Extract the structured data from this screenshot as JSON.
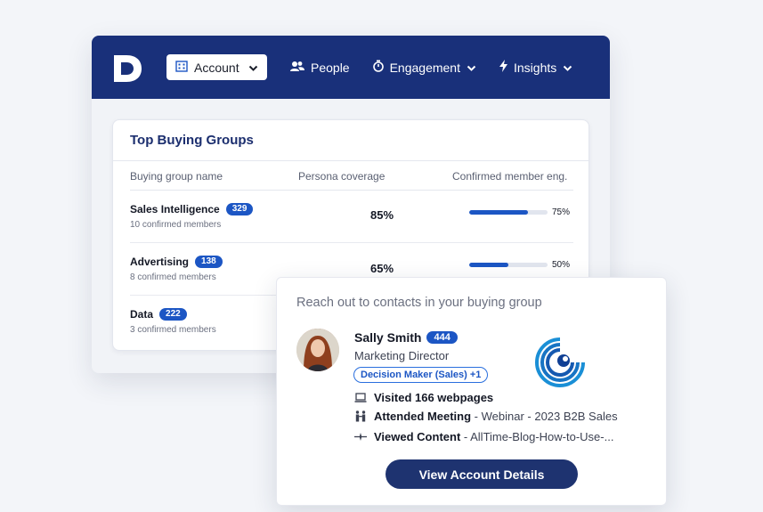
{
  "nav": {
    "account_label": "Account",
    "people_label": "People",
    "engagement_label": "Engagement",
    "insights_label": "Insights"
  },
  "card": {
    "title": "Top Buying Groups",
    "columns": [
      "Buying group name",
      "Persona coverage",
      "Confirmed member eng."
    ],
    "rows": [
      {
        "name": "Sales Intelligence",
        "count": "329",
        "sub": "10 confirmed members",
        "coverage": "85%",
        "engagement": 0.75,
        "engagement_label": "75%"
      },
      {
        "name": "Advertising",
        "count": "138",
        "sub": "8 confirmed members",
        "coverage": "65%",
        "engagement": 0.5,
        "engagement_label": "50%"
      },
      {
        "name": "Data",
        "count": "222",
        "sub": "3 confirmed members",
        "coverage": "",
        "engagement": null,
        "engagement_label": ""
      }
    ]
  },
  "popup": {
    "title": "Reach out to contacts in your buying group",
    "contact_name": "Sally Smith",
    "contact_count": "444",
    "contact_title": "Marketing Director",
    "tag": "Decision Maker (Sales) +1",
    "activities": [
      {
        "icon": "laptop-icon",
        "bold": "Visited 166 webpages",
        "rest": ""
      },
      {
        "icon": "meeting-icon",
        "bold": "Attended Meeting",
        "rest": " - Webinar - 2023 B2B Sales"
      },
      {
        "icon": "sparkle-icon",
        "bold": "Viewed Content",
        "rest": " - AllTime-Blog-How-to-Use-..."
      }
    ],
    "cta_label": "View Account Details"
  },
  "colors": {
    "brand_navy": "#19307a",
    "accent_blue": "#1c56c4",
    "cta_navy": "#1e3370"
  }
}
